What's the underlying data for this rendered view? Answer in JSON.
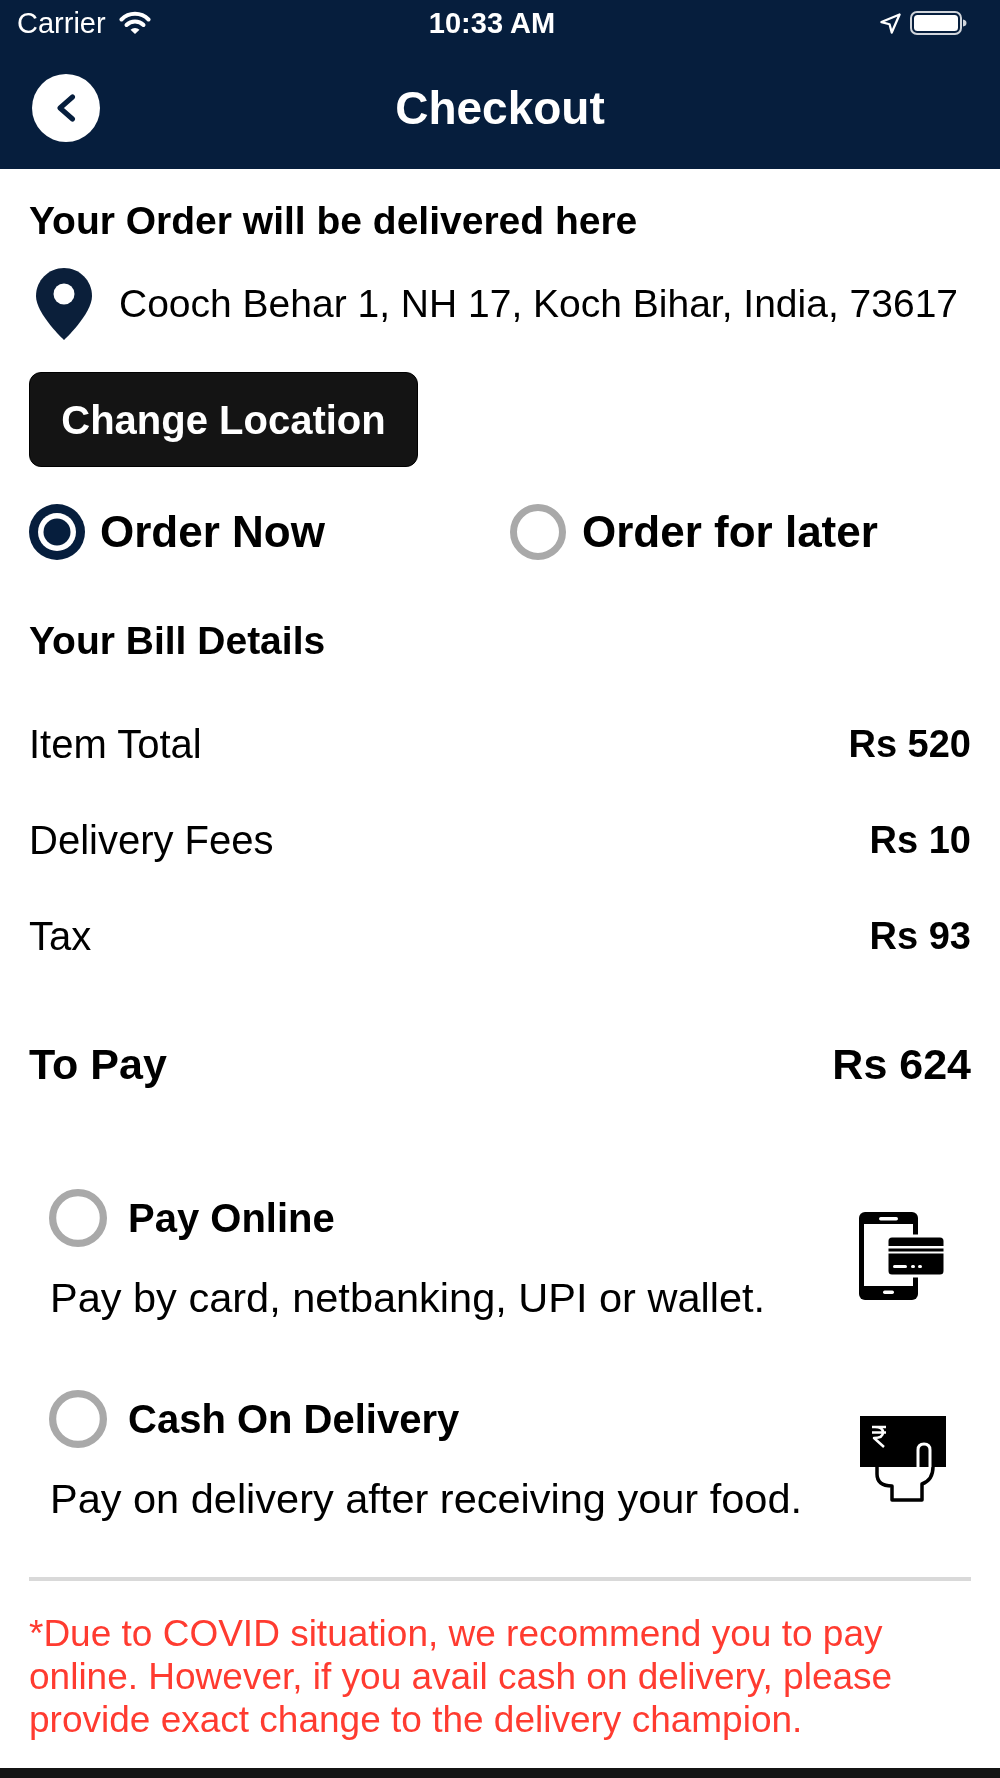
{
  "status_bar": {
    "carrier": "Carrier",
    "time": "10:33 AM"
  },
  "header": {
    "title": "Checkout"
  },
  "delivery": {
    "heading": "Your Order will be delivered here",
    "address": "Cooch Behar 1, NH 17, Koch Bihar, India, 73617",
    "button": "Change Location"
  },
  "order_options": [
    {
      "label": "Order Now",
      "selected": true
    },
    {
      "label": "Order for later",
      "selected": false
    }
  ],
  "bill": {
    "heading": "Your Bill Details",
    "rows": [
      {
        "label": "Item Total",
        "amount": "Rs 520"
      },
      {
        "label": "Delivery Fees",
        "amount": "Rs 10"
      },
      {
        "label": "Tax",
        "amount": "Rs 93"
      }
    ],
    "total": {
      "label": "To Pay",
      "amount": "Rs 624"
    }
  },
  "payment_methods": [
    {
      "kind": "online",
      "title": "Pay Online",
      "description": "Pay by card, netbanking, UPI or wallet.",
      "selected": false
    },
    {
      "kind": "cash",
      "title": "Cash On Delivery",
      "description": "Pay on delivery after receiving your food.",
      "selected": false
    }
  ],
  "notice": "*Due to COVID situation, we recommend you to pay online. However, if you avail cash on delivery, please provide exact change to the delivery champion."
}
